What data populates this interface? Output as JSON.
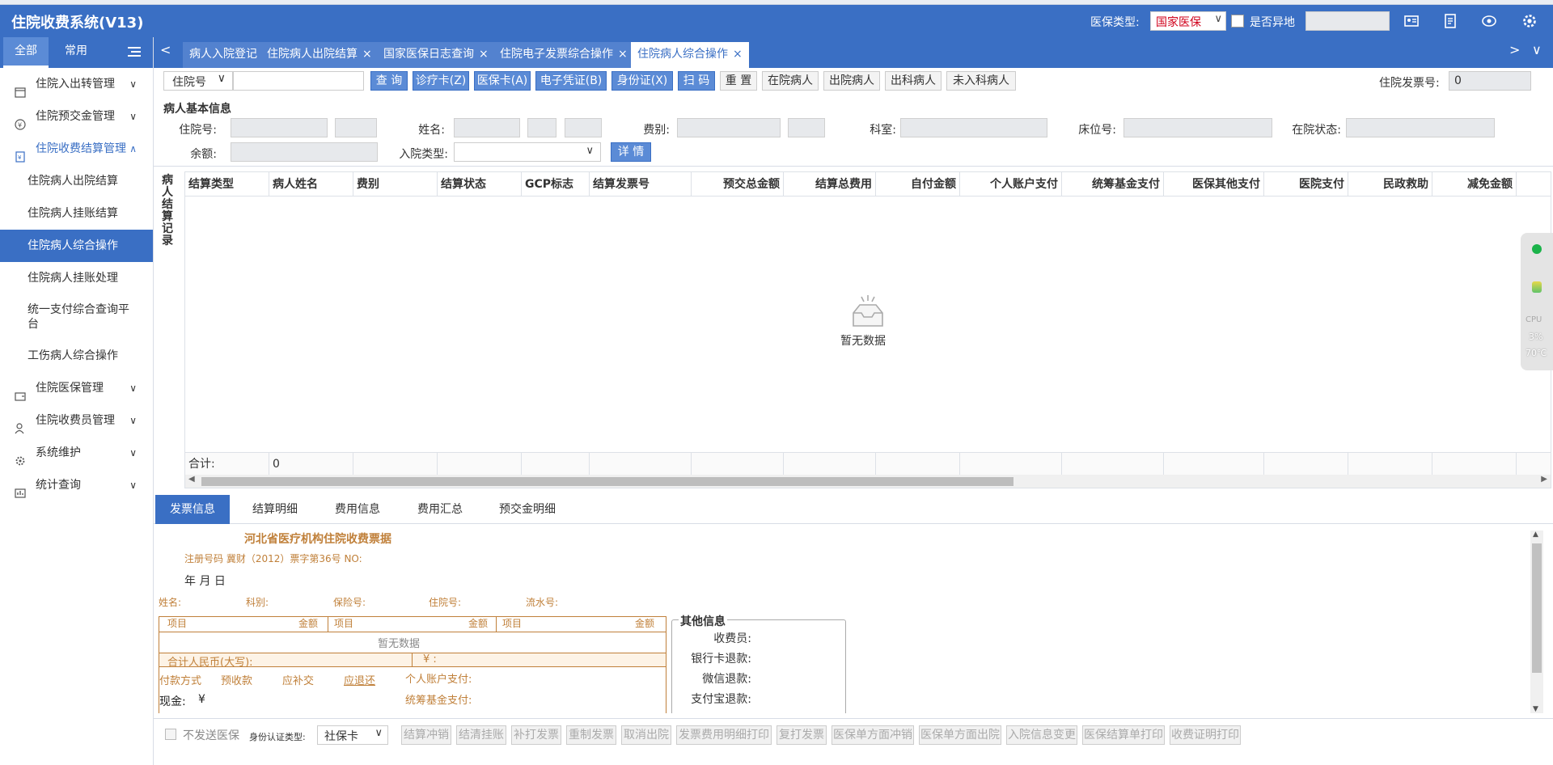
{
  "app": {
    "title": "住院收费系统(V13)",
    "insurance_type_label": "医保类型:",
    "insurance_type_value": "国家医保",
    "remote_label": "是否异地",
    "accent": "#3a6fc4",
    "highlight": "#d0021b"
  },
  "sidebar": {
    "tabs": [
      "全部",
      "常用"
    ],
    "groups": [
      {
        "label": "住院入出转管理"
      },
      {
        "label": "住院预交金管理"
      },
      {
        "label": "住院收费结算管理",
        "items": [
          "住院病人出院结算",
          "住院病人挂账结算",
          "住院病人综合操作",
          "住院病人挂账处理",
          "统一支付综合查询平台",
          "工伤病人综合操作"
        ]
      },
      {
        "label": "住院医保管理"
      },
      {
        "label": "住院收费员管理"
      },
      {
        "label": "系统维护"
      },
      {
        "label": "统计查询"
      }
    ]
  },
  "tabs": [
    {
      "label": "病人入院登记"
    },
    {
      "label": "住院病人出院结算"
    },
    {
      "label": "国家医保日志查询"
    },
    {
      "label": "住院电子发票综合操作"
    },
    {
      "label": "住院病人综合操作"
    }
  ],
  "toolbar": {
    "search_type": "住院号",
    "buttons": [
      "查 询",
      "诊疗卡(Z)",
      "医保卡(A)",
      "电子凭证(B)",
      "身份证(X)",
      "扫 码"
    ],
    "plain_buttons": [
      "重 置",
      "在院病人",
      "出院病人",
      "出科病人",
      "未入科病人"
    ],
    "invoice_label": "住院发票号:",
    "invoice_value": "0"
  },
  "patient": {
    "section_title": "病人基本信息",
    "labels": {
      "inpatient_no": "住院号:",
      "name": "姓名:",
      "fee_type": "费别:",
      "dept": "科室:",
      "bed": "床位号:",
      "status": "在院状态:",
      "balance": "余额:",
      "admit_type": "入院类型:"
    },
    "detail_button": "详 情"
  },
  "records": {
    "vertical_label": "病人结算记录",
    "columns": [
      "结算类型",
      "病人姓名",
      "费别",
      "结算状态",
      "GCP标志",
      "结算发票号",
      "预交总金额",
      "结算总费用",
      "自付金额",
      "个人账户支付",
      "统筹基金支付",
      "医保其他支付",
      "医院支付",
      "民政救助",
      "减免金额"
    ],
    "empty_text": "暂无数据",
    "total_label": "合计:",
    "total_value": "0"
  },
  "bottom_tabs": [
    "发票信息",
    "结算明细",
    "费用信息",
    "费用汇总",
    "预交金明细"
  ],
  "receipt": {
    "title": "河北省医疗机构住院收费票据",
    "reg": "注册号码 冀财（2012）票字第36号 NO:",
    "date": "年 月 日",
    "fields": [
      "姓名:",
      "科别:",
      "保险号:",
      "住院号:",
      "流水号:"
    ],
    "col_item": "项目",
    "col_amount": "金额",
    "empty": "暂无数据",
    "total_rmb": "合计人民币(大写):",
    "yen": "¥ :",
    "pay_method": "付款方式",
    "prepaid": "预收款",
    "supplement": "应补交",
    "refund": "应退还",
    "personal_account": "个人账户支付:",
    "pool_fund": "统筹基金支付:",
    "cash": "现金:",
    "cash_yen": "¥"
  },
  "other_info": {
    "title": "其他信息",
    "rows": [
      "收费员:",
      "银行卡退款:",
      "微信退款:",
      "支付宝退款:"
    ]
  },
  "bottombar": {
    "no_send_label": "不发送医保",
    "id_type_label": "身份认证类型:",
    "id_type_value": "社保卡",
    "buttons": [
      "结算冲销",
      "结清挂账",
      "补打发票",
      "重制发票",
      "取消出院",
      "发票费用明细打印",
      "复打发票",
      "医保单方面冲销",
      "医保单方面出院",
      "入院信息变更",
      "医保结算单打印",
      "收费证明打印"
    ]
  },
  "widget": {
    "cpu_label": "CPU",
    "cpu_value": "3%",
    "temp_value": "70℃"
  }
}
